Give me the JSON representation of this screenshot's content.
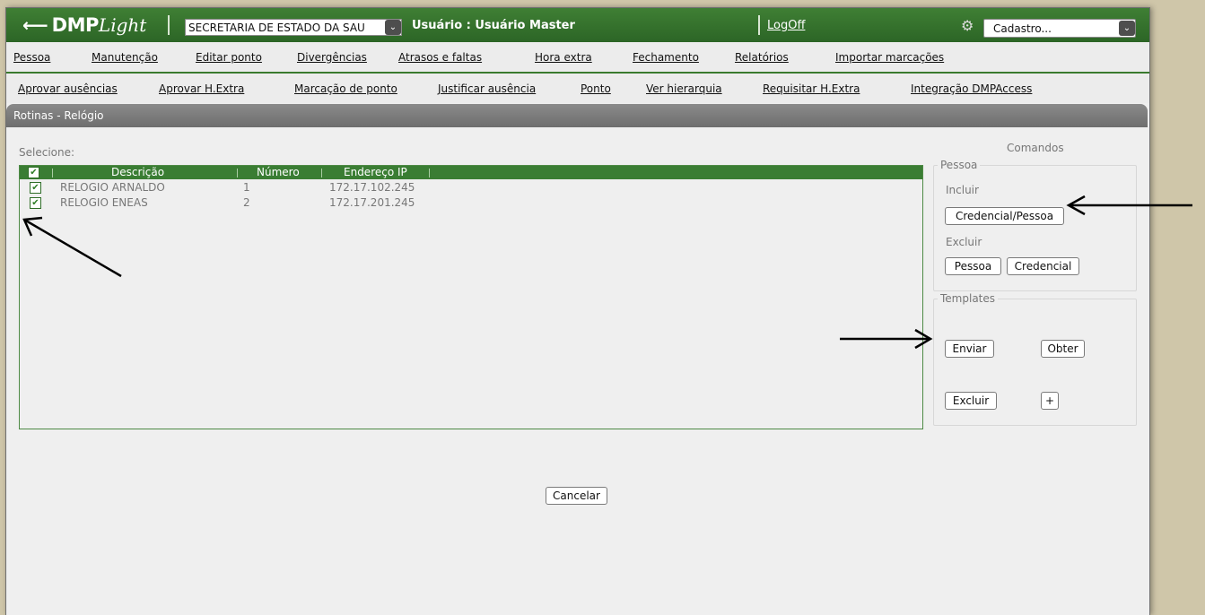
{
  "header": {
    "logo_bold": "DMP",
    "logo_light": "Light",
    "org_select": "SECRETARIA DE ESTADO DA SAU",
    "user_label": "Usuário : Usuário Master",
    "logoff": "LogOff",
    "cadastro_select": "Cadastro..."
  },
  "menu1": [
    "Pessoa",
    "Manutenção",
    "Editar ponto",
    "Divergências",
    "Atrasos e faltas",
    "Hora extra",
    "Fechamento",
    "Relatórios",
    "Importar marcações"
  ],
  "menu2": [
    "Aprovar ausências",
    "Aprovar H.Extra",
    "Marcação de ponto",
    "Justificar ausência",
    "Ponto",
    "Ver hierarquia",
    "Requisitar H.Extra",
    "Integração DMPAccess"
  ],
  "section_title": "Rotinas - Relógio",
  "select_label": "Selecione:",
  "grid": {
    "columns": [
      "Descrição",
      "Número",
      "Endereço IP"
    ],
    "rows": [
      {
        "descricao": "RELOGIO ARNALDO",
        "numero": "1",
        "ip": "172.17.102.245"
      },
      {
        "descricao": "RELOGIO ENEAS",
        "numero": "2",
        "ip": "172.17.201.245"
      }
    ]
  },
  "commands": {
    "title": "Comandos",
    "pessoa_legend": "Pessoa",
    "incluir_label": "Incluir",
    "credencial_pessoa": "Credencial/Pessoa",
    "excluir_label": "Excluir",
    "pessoa_btn": "Pessoa",
    "credencial_btn": "Credencial",
    "templates_legend": "Templates",
    "enviar": "Enviar",
    "obter": "Obter",
    "excluir_btn": "Excluir",
    "plus": "+"
  },
  "cancelar": "Cancelar",
  "check_glyph": "✔",
  "dropdown_glyph": "⌄",
  "gear_glyph": "⚙"
}
